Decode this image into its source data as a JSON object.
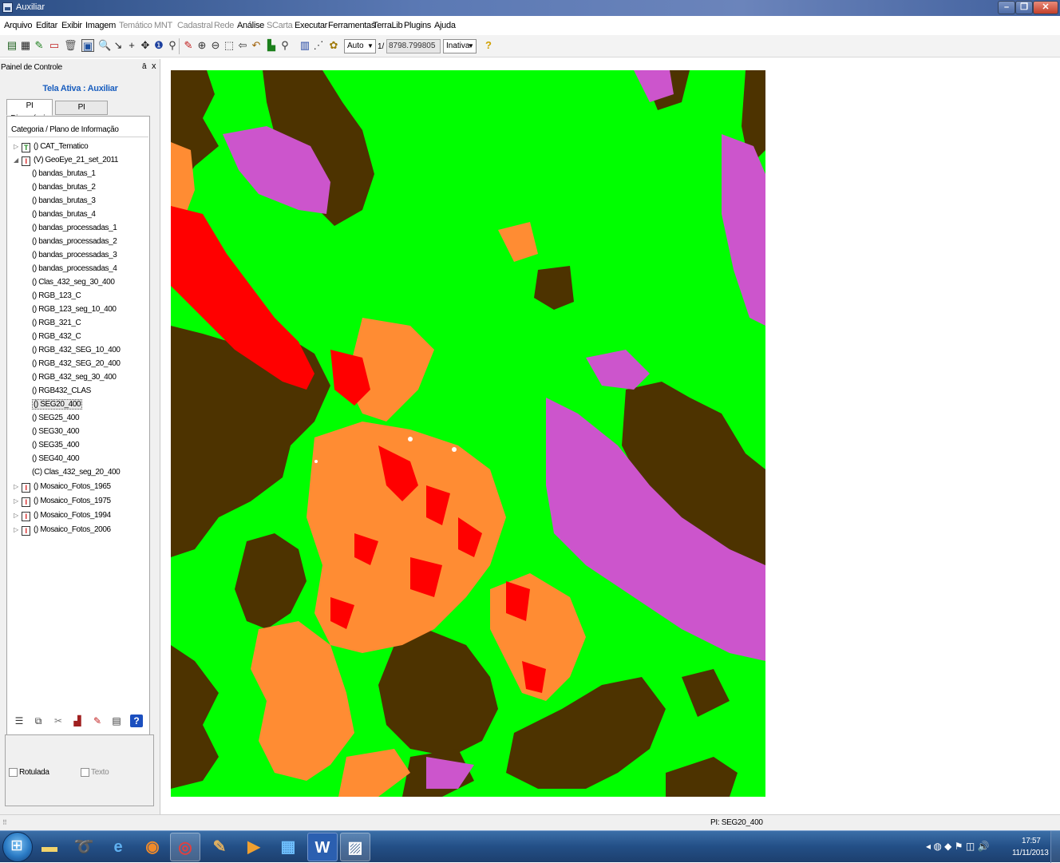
{
  "window": {
    "title": "Auxiliar"
  },
  "colors": {
    "vegetation": "#00ff00",
    "dark_vegetation": "#4d3300",
    "water": "#cc55cc",
    "urban": "#ff8c33",
    "bare_red": "#ff0000",
    "cloud": "#ffffff"
  },
  "menu": {
    "items": [
      {
        "label": "Arquivo",
        "enabled": true
      },
      {
        "label": "Editar",
        "enabled": true
      },
      {
        "label": "Exibir",
        "enabled": true
      },
      {
        "label": "Imagem",
        "enabled": true
      },
      {
        "label": "Temático",
        "enabled": false
      },
      {
        "label": "MNT",
        "enabled": false
      },
      {
        "label": "Cadastral",
        "enabled": false
      },
      {
        "label": "Rede",
        "enabled": false
      },
      {
        "label": "Análise",
        "enabled": true
      },
      {
        "label": "SCarta",
        "enabled": false
      },
      {
        "label": "Executar",
        "enabled": true
      },
      {
        "label": "Ferramentas",
        "enabled": true
      },
      {
        "label": "TerraLib",
        "enabled": true
      },
      {
        "label": "Plugins",
        "enabled": true
      },
      {
        "label": "Ajuda",
        "enabled": true
      }
    ]
  },
  "toolbar": {
    "zoom_mode": "Auto",
    "scale_prefix": "1/",
    "scale_value": "8798.799805",
    "state": "Inativa",
    "icons": [
      "database-icon",
      "grid-icon",
      "pencil-icon",
      "window-icon",
      "trash-icon",
      "select-icon",
      "zoom-icon",
      "cursor-icon",
      "pan-icon",
      "info-icon",
      "lens-icon",
      "edit-icon",
      "zoom-in-icon",
      "zoom-out-icon",
      "zoom-area-icon",
      "back-icon",
      "refresh-icon",
      "layers-icon",
      "zoom-tool-icon",
      "display-icon",
      "point-icon",
      "palette-icon",
      "help-icon"
    ]
  },
  "panel": {
    "title": "Painel de Controle",
    "pin": "ā",
    "close": "x",
    "active_screen": "Tela Ativa : Auxiliar",
    "tabs": [
      {
        "label": "PI Disponíveis"
      },
      {
        "label": "PI Selecionados"
      }
    ],
    "tree_header": "Categoria / Plano de Informação",
    "tree": [
      {
        "label": "() CAT_Tematico",
        "icon": "T",
        "level": 0,
        "expander": "▷"
      },
      {
        "label": "(V) GeoEye_21_set_2011",
        "icon": "I",
        "level": 0,
        "expander": "◢"
      },
      {
        "label": "() bandas_brutas_1",
        "level": 1
      },
      {
        "label": "() bandas_brutas_2",
        "level": 1
      },
      {
        "label": "() bandas_brutas_3",
        "level": 1
      },
      {
        "label": "() bandas_brutas_4",
        "level": 1
      },
      {
        "label": "() bandas_processadas_1",
        "level": 1
      },
      {
        "label": "() bandas_processadas_2",
        "level": 1
      },
      {
        "label": "() bandas_processadas_3",
        "level": 1
      },
      {
        "label": "() bandas_processadas_4",
        "level": 1
      },
      {
        "label": "() Clas_432_seg_30_400",
        "level": 1
      },
      {
        "label": "() RGB_123_C",
        "level": 1
      },
      {
        "label": "() RGB_123_seg_10_400",
        "level": 1
      },
      {
        "label": "() RGB_321_C",
        "level": 1
      },
      {
        "label": "() RGB_432_C",
        "level": 1
      },
      {
        "label": "() RGB_432_SEG_10_400",
        "level": 1
      },
      {
        "label": "() RGB_432_SEG_20_400",
        "level": 1
      },
      {
        "label": "() RGB_432_seg_30_400",
        "level": 1
      },
      {
        "label": "() RGB432_CLAS",
        "level": 1
      },
      {
        "label": "() SEG20_400",
        "level": 1,
        "selected": true
      },
      {
        "label": "() SEG25_400",
        "level": 1
      },
      {
        "label": "() SEG30_400",
        "level": 1
      },
      {
        "label": "() SEG35_400",
        "level": 1
      },
      {
        "label": "() SEG40_400",
        "level": 1
      },
      {
        "label": "(C) Clas_432_seg_20_400",
        "level": 1
      },
      {
        "label": "() Mosaico_Fotos_1965",
        "icon": "I",
        "level": 0,
        "expander": "▷"
      },
      {
        "label": "() Mosaico_Fotos_1975",
        "icon": "I",
        "level": 0,
        "expander": "▷"
      },
      {
        "label": "() Mosaico_Fotos_1994",
        "icon": "I",
        "level": 0,
        "expander": "▷"
      },
      {
        "label": "() Mosaico_Fotos_2006",
        "icon": "I",
        "level": 0,
        "expander": "▷"
      }
    ],
    "tools": [
      "list-icon",
      "properties-icon",
      "style-icon",
      "visual-icon",
      "edit-layer-icon",
      "table-icon",
      "help-icon"
    ],
    "rotulada": "Rotulada",
    "texto": "Texto"
  },
  "status": {
    "text": "PI: SEG20_400"
  },
  "taskbar": {
    "apps": [
      "explorer-icon",
      "app-icon",
      "ie-icon",
      "firefox-icon",
      "chrome-icon",
      "paint-icon",
      "media-icon",
      "calculator-icon",
      "word-icon",
      "spring-icon"
    ],
    "time": "17:57",
    "date": "11/11/2013"
  }
}
